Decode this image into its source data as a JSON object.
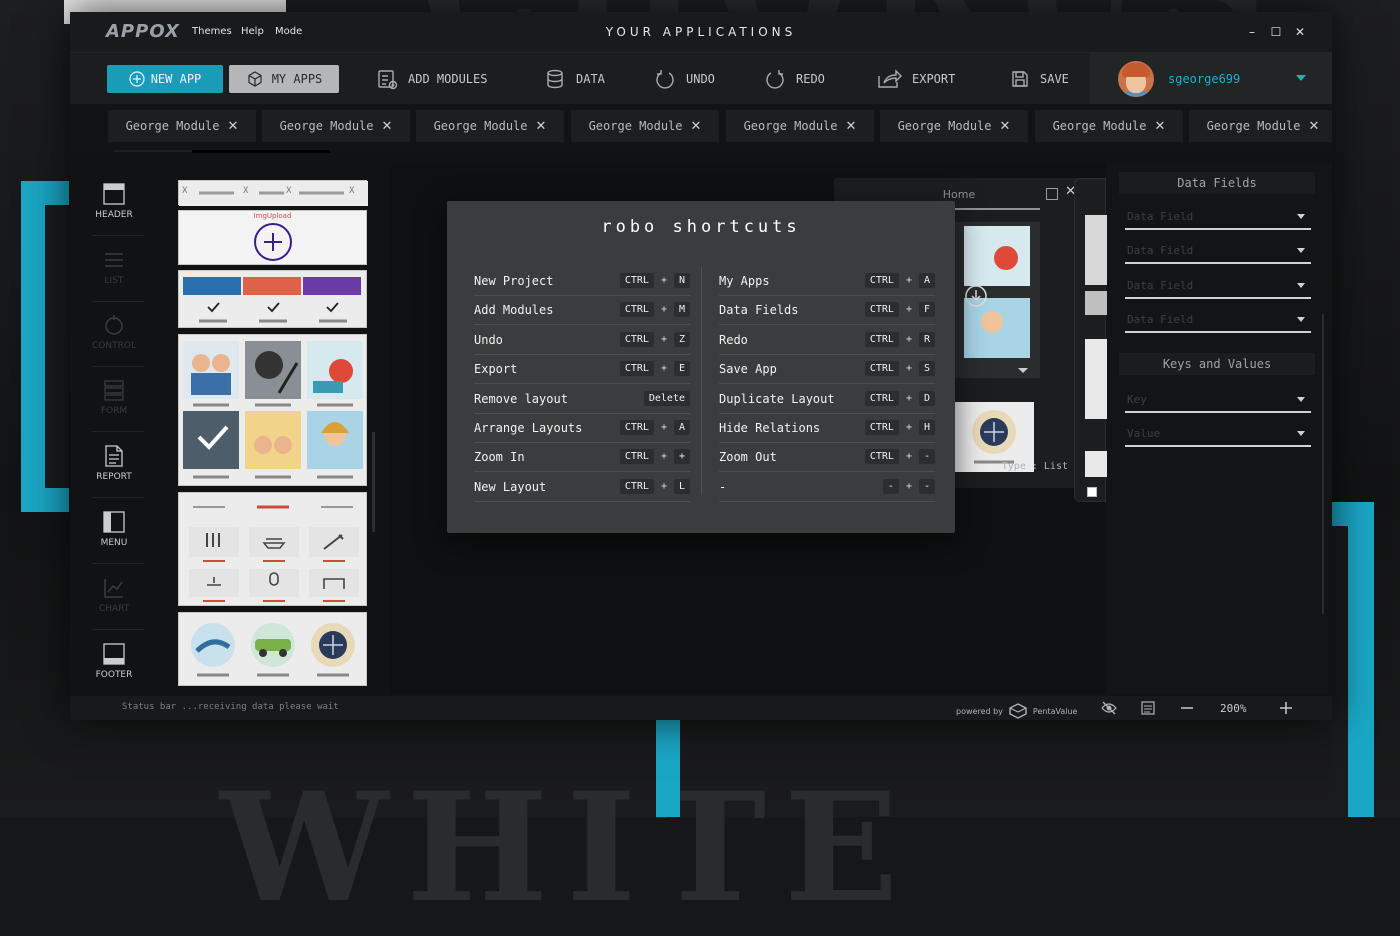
{
  "window": {
    "logo": "APPOX",
    "menu": [
      "Themes",
      "Help",
      "Mode"
    ],
    "title": "YOUR APPLICATIONS",
    "controls": [
      "–",
      "☐",
      "✕"
    ]
  },
  "toolbar": {
    "new_app": "NEW APP",
    "my_apps": "MY APPS",
    "add_modules": "ADD MODULES",
    "data": "DATA",
    "undo": "UNDO",
    "redo": "REDO",
    "export": "EXPORT",
    "save": "SAVE",
    "username": "sgeorge699",
    "accent": "#1a9cb8"
  },
  "tabs": [
    "George Module",
    "George Module",
    "George Module",
    "George Module",
    "George Module",
    "George Module",
    "George Module",
    "George Module"
  ],
  "leftnav": [
    {
      "label": "HEADER",
      "icon": "header-icon",
      "active": true
    },
    {
      "label": "LIST",
      "icon": "list-icon",
      "active": false
    },
    {
      "label": "CONTROL",
      "icon": "control-icon",
      "active": false
    },
    {
      "label": "FORM",
      "icon": "form-icon",
      "active": false
    },
    {
      "label": "REPORT",
      "icon": "report-icon",
      "active": true
    },
    {
      "label": "MENU",
      "icon": "menu-icon",
      "active": true
    },
    {
      "label": "CHART",
      "icon": "chart-icon",
      "active": false
    },
    {
      "label": "FOOTER",
      "icon": "footer-icon",
      "active": true
    }
  ],
  "thumbs": {
    "upload_label": "ImgUpload",
    "tab_strip_x": "X"
  },
  "canvas": {
    "card_title": "Home",
    "type_label": "Type : List"
  },
  "right_panel": {
    "data_fields_title": "Data Fields",
    "data_fields": [
      "Data Field",
      "Data Field",
      "Data Field",
      "Data Field"
    ],
    "keys_title": "Keys and Values",
    "key_placeholder": "Key",
    "value_placeholder": "Value"
  },
  "statusbar": {
    "text": "Status bar ...receiving data please wait",
    "powered_by": "powered by",
    "brand": "PentaValue",
    "zoom": "200%"
  },
  "shortcuts": {
    "title": "robo shortcuts",
    "left": [
      {
        "label": "New Project",
        "keys": [
          "CTRL",
          "+",
          "N"
        ]
      },
      {
        "label": "Add Modules",
        "keys": [
          "CTRL",
          "+",
          "M"
        ]
      },
      {
        "label": "Undo",
        "keys": [
          "CTRL",
          "+",
          "Z"
        ]
      },
      {
        "label": "Export",
        "keys": [
          "CTRL",
          "+",
          "E"
        ]
      },
      {
        "label": "Remove layout",
        "keys": [
          "Delete"
        ]
      },
      {
        "label": "Arrange Layouts",
        "keys": [
          "CTRL",
          "+",
          "A"
        ]
      },
      {
        "label": "Zoom In",
        "keys": [
          "CTRL",
          "+",
          "+"
        ]
      },
      {
        "label": "New Layout",
        "keys": [
          "CTRL",
          "+",
          "L"
        ]
      }
    ],
    "right": [
      {
        "label": "My Apps",
        "keys": [
          "CTRL",
          "+",
          "A"
        ]
      },
      {
        "label": "Data Fields",
        "keys": [
          "CTRL",
          "+",
          "F"
        ]
      },
      {
        "label": "Redo",
        "keys": [
          "CTRL",
          "+",
          "R"
        ]
      },
      {
        "label": "Save App",
        "keys": [
          "CTRL",
          "+",
          "S"
        ]
      },
      {
        "label": "Duplicate Layout",
        "keys": [
          "CTRL",
          "+",
          "D"
        ]
      },
      {
        "label": "Hide Relations",
        "keys": [
          "CTRL",
          "+",
          "H"
        ]
      },
      {
        "label": "Zoom Out",
        "keys": [
          "CTRL",
          "+",
          "-"
        ]
      },
      {
        "label": "-",
        "keys": [
          "-",
          "+",
          "-"
        ]
      }
    ]
  }
}
